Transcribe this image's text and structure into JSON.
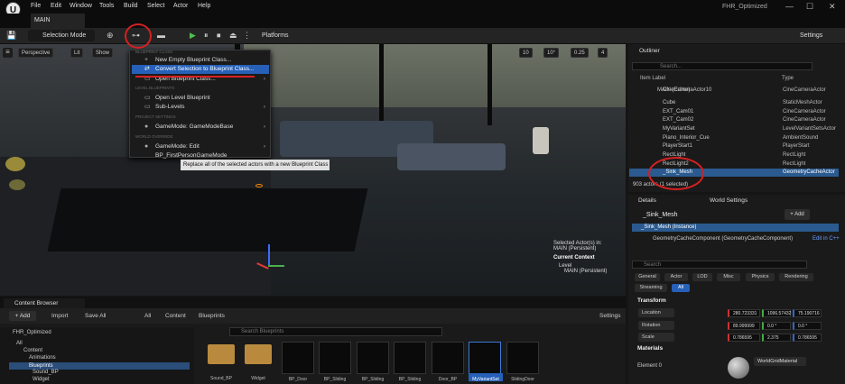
{
  "app": {
    "logo": "U",
    "project_name": "FHR_Optimized",
    "win_min": "—",
    "win_max": "☐",
    "win_close": "✕"
  },
  "menu": [
    "File",
    "Edit",
    "Window",
    "Tools",
    "Build",
    "Select",
    "Actor",
    "Help"
  ],
  "tab": {
    "label": "MAIN"
  },
  "toolbar": {
    "save_icon": "💾",
    "selection_mode": "Selection Mode",
    "platforms": "Platforms",
    "settings": "Settings",
    "play": "▶",
    "pause": "⏸",
    "stop": "⏹",
    "eject": "⏏"
  },
  "viewport": {
    "perspective": "Perspective",
    "lit": "Lit",
    "show": "Show",
    "grid1": "10",
    "grid2": "10°",
    "grid3": "0.25",
    "grid4": "4"
  },
  "dropdown": {
    "sec1": "BLUEPRINT CLASS",
    "item1": "New Empty Blueprint Class...",
    "item2": "Convert Selection to Blueprint Class...",
    "item3": "Open Blueprint Class...",
    "sec2": "LEVEL BLUEPRINTS",
    "item4": "Open Level Blueprint",
    "item5": "Sub-Levels",
    "sec3": "PROJECT SETTINGS",
    "item6": "GameMode: GameModeBase",
    "sec4": "WORLD OVERRIDE",
    "item7": "GameMode: Edit BP_FirstPersonGameMode"
  },
  "tooltip": "Replace all of the selected actors with a new Blueprint Class",
  "selinfo": {
    "line1": "Selected Actor(s) in:",
    "line2": "MAIN (Persistent)",
    "context": "Current Context",
    "level_label": "Level",
    "level_value": "MAIN (Persistent)"
  },
  "outliner": {
    "title": "Outliner",
    "search": "Search...",
    "col_label": "Item Label",
    "col_type": "Type",
    "rows": [
      {
        "name": "CineCameraActor10",
        "type": "CineCameraActor"
      },
      {
        "name": "MAIN (Editor)",
        "type": ""
      },
      {
        "name": "Cube",
        "type": "StaticMeshActor"
      },
      {
        "name": "EXT_Cam01",
        "type": "CineCameraActor"
      },
      {
        "name": "EXT_Cam02",
        "type": "CineCameraActor"
      },
      {
        "name": "MyVariantSet",
        "type": "LevelVariantSetsActor"
      },
      {
        "name": "Piano_Interior_Cue",
        "type": "AmbientSound"
      },
      {
        "name": "PlayerStart1",
        "type": "PlayerStart"
      },
      {
        "name": "RectLight",
        "type": "RectLight"
      },
      {
        "name": "RectLight2",
        "type": "RectLight"
      },
      {
        "name": "_Sink_Mesh",
        "type": "GeometryCacheActor"
      }
    ],
    "count": "903 actors (1 selected)"
  },
  "details": {
    "tab1": "Details",
    "tab2": "World Settings",
    "actor": "_Sink_Mesh",
    "add": "+ Add",
    "instance": "_Sink_Mesh (Instance)",
    "component": "GeometryCacheComponent (GeometryCacheComponent)",
    "edit_cpp": "Edit in C++",
    "search": "Search",
    "filters": [
      "General",
      "Actor",
      "LOD",
      "Misc",
      "Physics",
      "Rendering",
      "Streaming",
      "All"
    ],
    "transform": "Transform",
    "location": "Location",
    "rotation": "Rotation",
    "scale": "Scale",
    "loc": [
      "280.723331",
      "1096.57432",
      "75.190716"
    ],
    "rot": [
      "89.999999",
      "0.0 °",
      "0.0 °"
    ],
    "scl": [
      "0.786595",
      "2.375",
      "0.786595"
    ],
    "materials": "Materials",
    "element0": "Element 0",
    "material": "WorldGridMaterial"
  },
  "content_browser": {
    "tab": "Content Browser",
    "add": "+ Add",
    "import": "Import",
    "save_all": "Save All",
    "crumbs": [
      "All",
      "Content",
      "Blueprints"
    ],
    "settings": "Settings",
    "search": "Search Blueprints",
    "tree": [
      "FHR_Optimized",
      "All",
      "Content",
      "Animations",
      "Blueprints",
      "Sound_BP",
      "Widget"
    ],
    "assets": [
      "Sound_BP",
      "Widget",
      "BP_Door",
      "BP_Sliding",
      "BP_Sliding",
      "BP_Sliding",
      "Door_BP",
      "MyVariantSet",
      "SlidingDoor"
    ]
  }
}
